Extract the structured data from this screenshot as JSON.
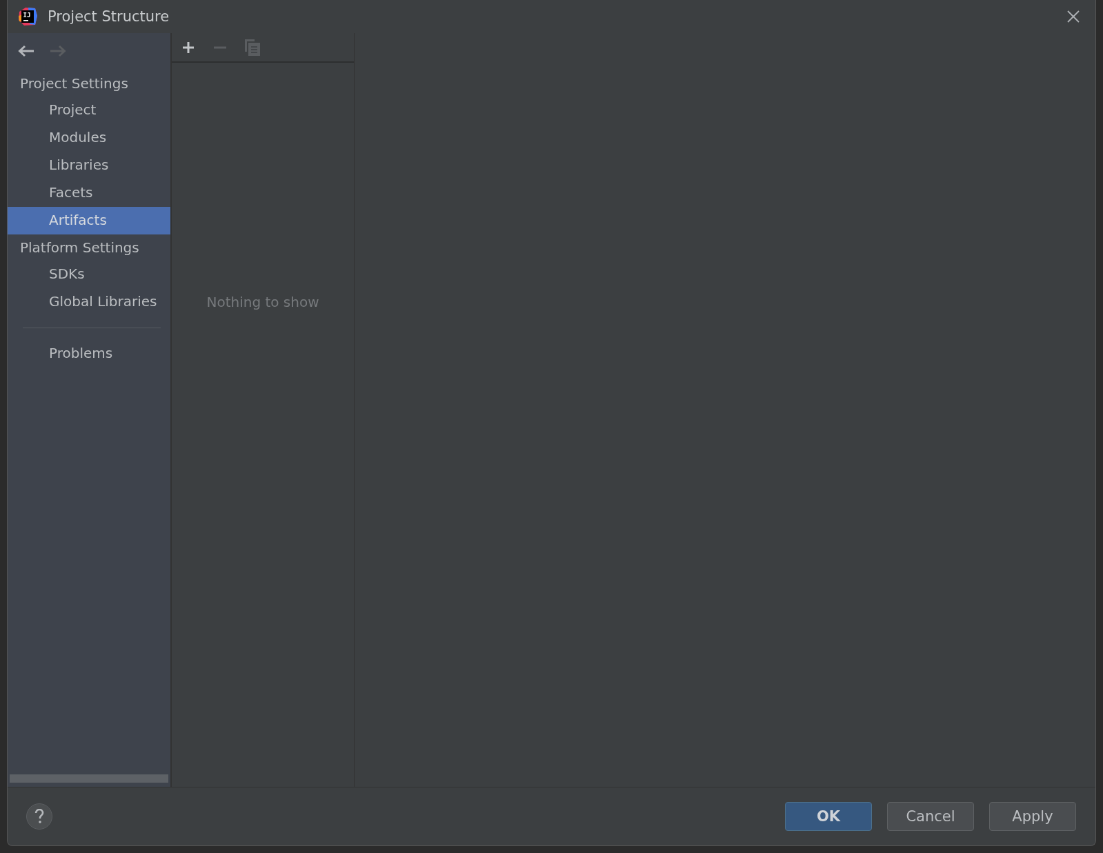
{
  "window": {
    "title": "Project Structure",
    "logo_text": "IJ"
  },
  "nav": {
    "back_disabled": false,
    "forward_disabled": true
  },
  "sidebar": {
    "items": [
      {
        "kind": "header",
        "label": "Project Settings",
        "selected": false
      },
      {
        "kind": "item",
        "label": "Project",
        "selected": false
      },
      {
        "kind": "item",
        "label": "Modules",
        "selected": false
      },
      {
        "kind": "item",
        "label": "Libraries",
        "selected": false
      },
      {
        "kind": "item",
        "label": "Facets",
        "selected": false
      },
      {
        "kind": "item",
        "label": "Artifacts",
        "selected": true
      },
      {
        "kind": "header",
        "label": "Platform Settings",
        "selected": false
      },
      {
        "kind": "item",
        "label": "SDKs",
        "selected": false
      },
      {
        "kind": "item",
        "label": "Global Libraries",
        "selected": false
      },
      {
        "kind": "separator"
      },
      {
        "kind": "item",
        "label": "Problems",
        "selected": false
      }
    ]
  },
  "toolbar": {
    "add_disabled": false,
    "remove_disabled": true,
    "copy_disabled": true
  },
  "list": {
    "empty_text": "Nothing to show"
  },
  "buttons": [
    {
      "label": "OK",
      "primary": true
    },
    {
      "label": "Cancel",
      "primary": false
    },
    {
      "label": "Apply",
      "primary": false
    }
  ]
}
